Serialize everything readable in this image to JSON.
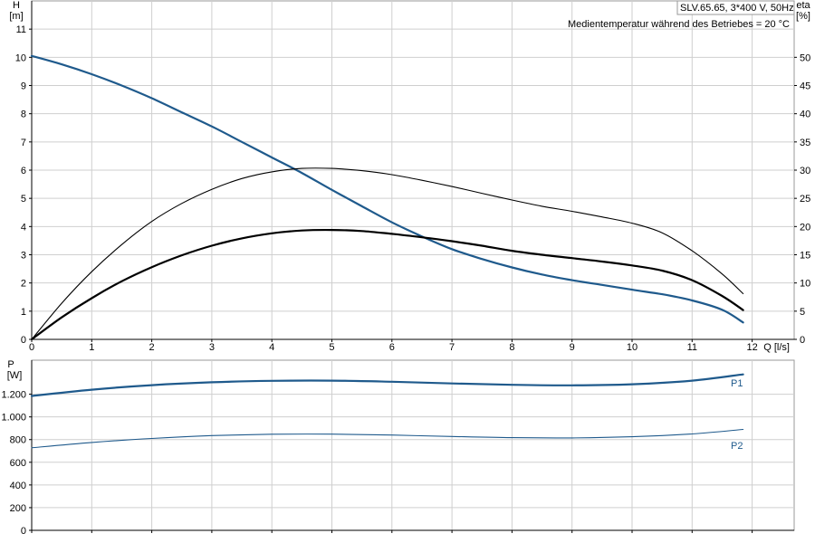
{
  "chart_data": [
    {
      "type": "line",
      "title": "SLV.65.65, 3*400 V, 50Hz",
      "subtitle": "Medientemperatur während des Betriebes = 20 °C",
      "xlabel": "Q [l/s]",
      "x_unit": "Q [l/s]",
      "ylabel": "H",
      "ylabel_unit": "[m]",
      "y2label": "eta",
      "y2label_unit": "[%]",
      "xlim": [
        0,
        12.7
      ],
      "ylim": [
        0,
        12
      ],
      "y2lim": [
        0,
        60
      ],
      "x_ticks": [
        0,
        1,
        2,
        3,
        4,
        5,
        6,
        7,
        8,
        9,
        10,
        11,
        12
      ],
      "y_ticks": [
        0,
        1,
        2,
        3,
        4,
        5,
        6,
        7,
        8,
        9,
        10,
        11
      ],
      "y2_ticks": [
        0,
        5,
        10,
        15,
        20,
        25,
        30,
        35,
        40,
        45,
        50
      ],
      "grid": true,
      "series": [
        {
          "axis": "left",
          "color": "#1f5a8c",
          "width": 2.2,
          "x": [
            0,
            0.5,
            1,
            1.5,
            2,
            2.5,
            3,
            3.5,
            4,
            4.5,
            5,
            5.5,
            6,
            6.5,
            7,
            7.5,
            8,
            8.5,
            9,
            9.5,
            10,
            10.5,
            11,
            11.5,
            11.85
          ],
          "y": [
            10.05,
            9.75,
            9.4,
            9.0,
            8.55,
            8.05,
            7.55,
            7.0,
            6.45,
            5.9,
            5.3,
            4.72,
            4.15,
            3.65,
            3.2,
            2.85,
            2.55,
            2.3,
            2.1,
            1.93,
            1.76,
            1.6,
            1.38,
            1.05,
            0.6
          ]
        },
        {
          "axis": "right",
          "color": "#000000",
          "width": 2.2,
          "x": [
            0,
            0.5,
            1,
            1.5,
            2,
            2.5,
            3,
            3.5,
            4,
            4.5,
            5,
            5.5,
            6,
            6.5,
            7,
            7.5,
            8,
            8.5,
            9,
            9.5,
            10,
            10.5,
            11,
            11.5,
            11.85
          ],
          "y": [
            0,
            3.9,
            7.3,
            10.3,
            12.8,
            14.9,
            16.6,
            17.9,
            18.8,
            19.3,
            19.4,
            19.2,
            18.7,
            18.1,
            17.4,
            16.6,
            15.7,
            15.0,
            14.4,
            13.8,
            13.1,
            12.2,
            10.5,
            7.7,
            5.2
          ]
        },
        {
          "axis": "right",
          "color": "#000000",
          "width": 1.1,
          "x": [
            0,
            0.5,
            1,
            1.5,
            2,
            2.5,
            3,
            3.5,
            4,
            4.5,
            5,
            5.5,
            6,
            6.5,
            7,
            7.5,
            8,
            8.5,
            9,
            9.5,
            10,
            10.5,
            11,
            11.5,
            11.85
          ],
          "y": [
            0,
            6.4,
            12.0,
            16.8,
            20.9,
            24.1,
            26.6,
            28.5,
            29.7,
            30.3,
            30.3,
            29.9,
            29.2,
            28.2,
            27.1,
            25.9,
            24.7,
            23.6,
            22.7,
            21.7,
            20.6,
            18.9,
            15.7,
            11.6,
            8.1
          ]
        }
      ]
    },
    {
      "type": "line",
      "xlabel": "",
      "ylabel": "P",
      "ylabel_unit": "[W]",
      "xlim": [
        0,
        12.7
      ],
      "ylim": [
        0,
        1500
      ],
      "x_ticks": [
        0,
        1,
        2,
        3,
        4,
        5,
        6,
        7,
        8,
        9,
        10,
        11,
        12
      ],
      "y_ticks": [
        0,
        200,
        400,
        600,
        800,
        1000,
        1200
      ],
      "y_tick_labels": [
        "0",
        "200",
        "400",
        "600",
        "800",
        "1.000",
        "1.200"
      ],
      "grid": true,
      "series": [
        {
          "name": "P1",
          "color": "#1f5a8c",
          "width": 2.2,
          "x": [
            0,
            1,
            2,
            3,
            4,
            5,
            6,
            7,
            8,
            9,
            10,
            11,
            11.85
          ],
          "y": [
            1185,
            1240,
            1280,
            1305,
            1318,
            1320,
            1310,
            1295,
            1283,
            1278,
            1288,
            1320,
            1375
          ]
        },
        {
          "name": "P2",
          "color": "#1f5a8c",
          "width": 1.1,
          "x": [
            0,
            1,
            2,
            3,
            4,
            5,
            6,
            7,
            8,
            9,
            10,
            11,
            11.85
          ],
          "y": [
            728,
            775,
            810,
            835,
            847,
            848,
            840,
            827,
            817,
            815,
            825,
            850,
            890
          ]
        }
      ]
    }
  ]
}
